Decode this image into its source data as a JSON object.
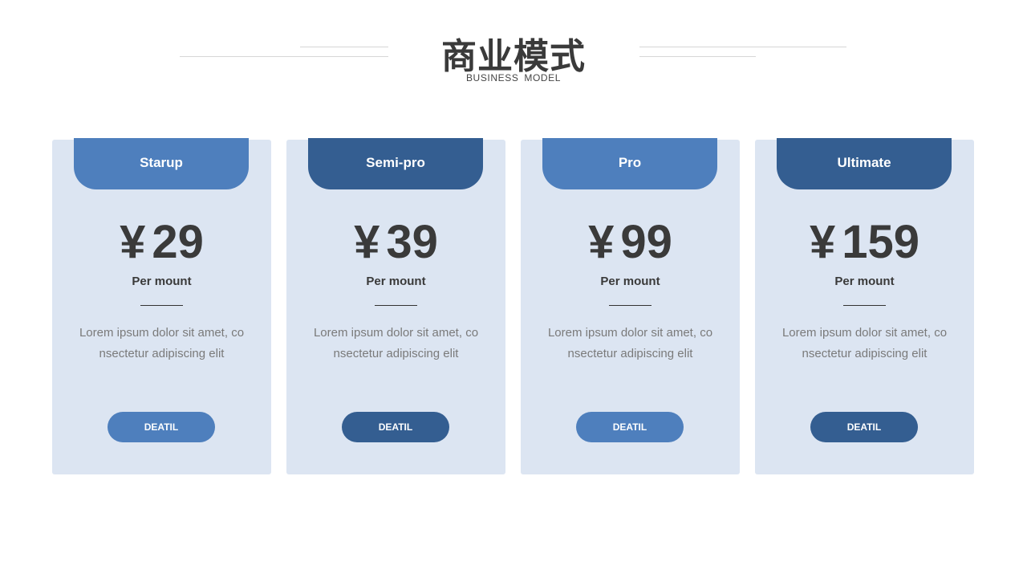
{
  "header": {
    "title": "商业模式",
    "subtitle": "BUSINESS MODEL"
  },
  "colors": {
    "accent_light": "#4e7fbd",
    "accent_dark": "#345e91",
    "card_bg": "#dce5f2",
    "text_dark": "#3a3a3a"
  },
  "plans": [
    {
      "name": "Starup",
      "currency": "¥",
      "price": "29",
      "period": "Per mount",
      "desc_line1": "Lorem ipsum dolor sit amet, co",
      "desc_line2": "nsectetur adipiscing elit",
      "button": "DEATIL"
    },
    {
      "name": "Semi-pro",
      "currency": "¥",
      "price": "39",
      "period": "Per mount",
      "desc_line1": "Lorem ipsum dolor sit amet, co",
      "desc_line2": "nsectetur adipiscing elit",
      "button": "DEATIL"
    },
    {
      "name": "Pro",
      "currency": "¥",
      "price": "99",
      "period": "Per mount",
      "desc_line1": "Lorem ipsum dolor sit amet, co",
      "desc_line2": "nsectetur adipiscing elit",
      "button": "DEATIL"
    },
    {
      "name": "Ultimate",
      "currency": "¥",
      "price": "159",
      "period": "Per mount",
      "desc_line1": "Lorem ipsum dolor sit amet, co",
      "desc_line2": "nsectetur adipiscing elit",
      "button": "DEATIL"
    }
  ]
}
